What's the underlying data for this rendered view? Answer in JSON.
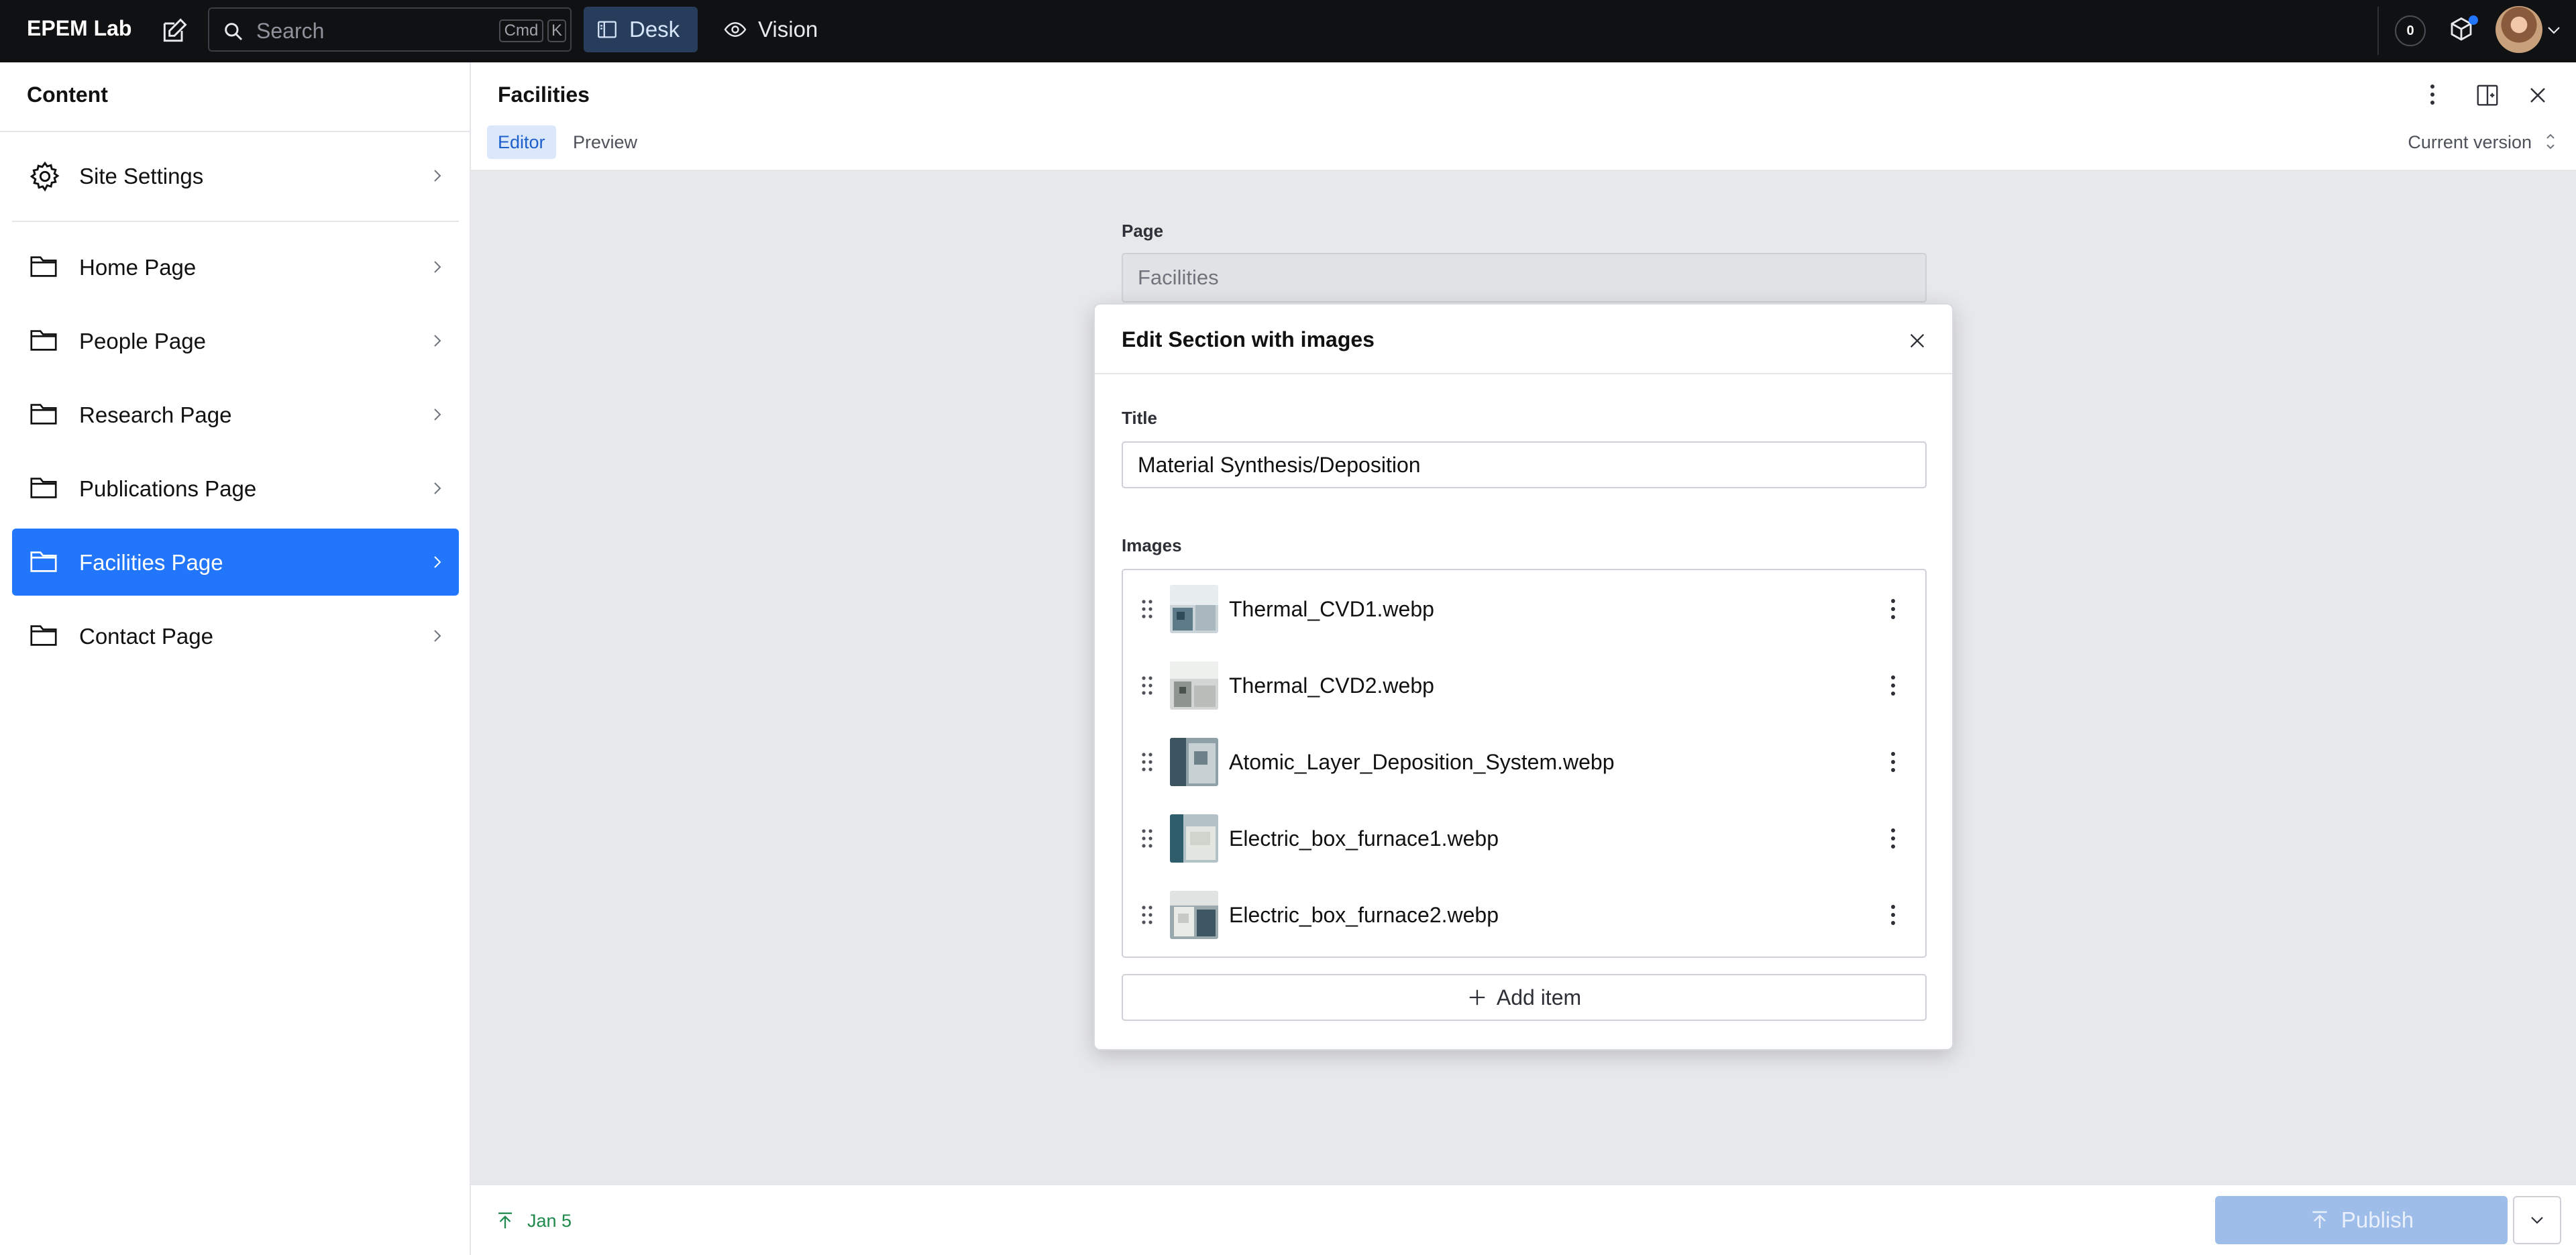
{
  "topbar": {
    "brand": "EPEM Lab",
    "search_placeholder": "Search",
    "shortcut_cmd": "Cmd",
    "shortcut_key": "K",
    "tools": [
      {
        "label": "Desk",
        "active": true,
        "icon": "desk-icon"
      },
      {
        "label": "Vision",
        "active": false,
        "icon": "eye-icon"
      }
    ],
    "notification_count": "0"
  },
  "sidebar": {
    "title": "Content",
    "items": [
      {
        "label": "Site Settings",
        "icon": "gear-icon",
        "active": false
      },
      {
        "label": "Home Page",
        "icon": "folder-icon",
        "active": false
      },
      {
        "label": "People Page",
        "icon": "folder-icon",
        "active": false
      },
      {
        "label": "Research Page",
        "icon": "folder-icon",
        "active": false
      },
      {
        "label": "Publications Page",
        "icon": "folder-icon",
        "active": false
      },
      {
        "label": "Facilities Page",
        "icon": "folder-icon",
        "active": true
      },
      {
        "label": "Contact Page",
        "icon": "folder-icon",
        "active": false
      }
    ]
  },
  "document": {
    "title": "Facilities",
    "tabs": [
      {
        "label": "Editor",
        "active": true
      },
      {
        "label": "Preview",
        "active": false
      }
    ],
    "version_label": "Current version",
    "page_field_label": "Page",
    "page_field_value": "Facilities"
  },
  "dialog": {
    "title": "Edit Section with images",
    "title_field_label": "Title",
    "title_field_value": "Material Synthesis/Deposition",
    "images_label": "Images",
    "images": [
      {
        "filename": "Thermal_CVD1.webp"
      },
      {
        "filename": "Thermal_CVD2.webp"
      },
      {
        "filename": "Atomic_Layer_Deposition_System.webp"
      },
      {
        "filename": "Electric_box_furnace1.webp"
      },
      {
        "filename": "Electric_box_furnace2.webp"
      }
    ],
    "add_item_label": "Add item"
  },
  "footer": {
    "status_date": "Jan 5",
    "publish_label": "Publish"
  },
  "colors": {
    "accent": "#2276fc",
    "topbar_bg": "#101112",
    "canvas_bg": "#e7e8ea",
    "published_green": "#1f8a4c"
  }
}
